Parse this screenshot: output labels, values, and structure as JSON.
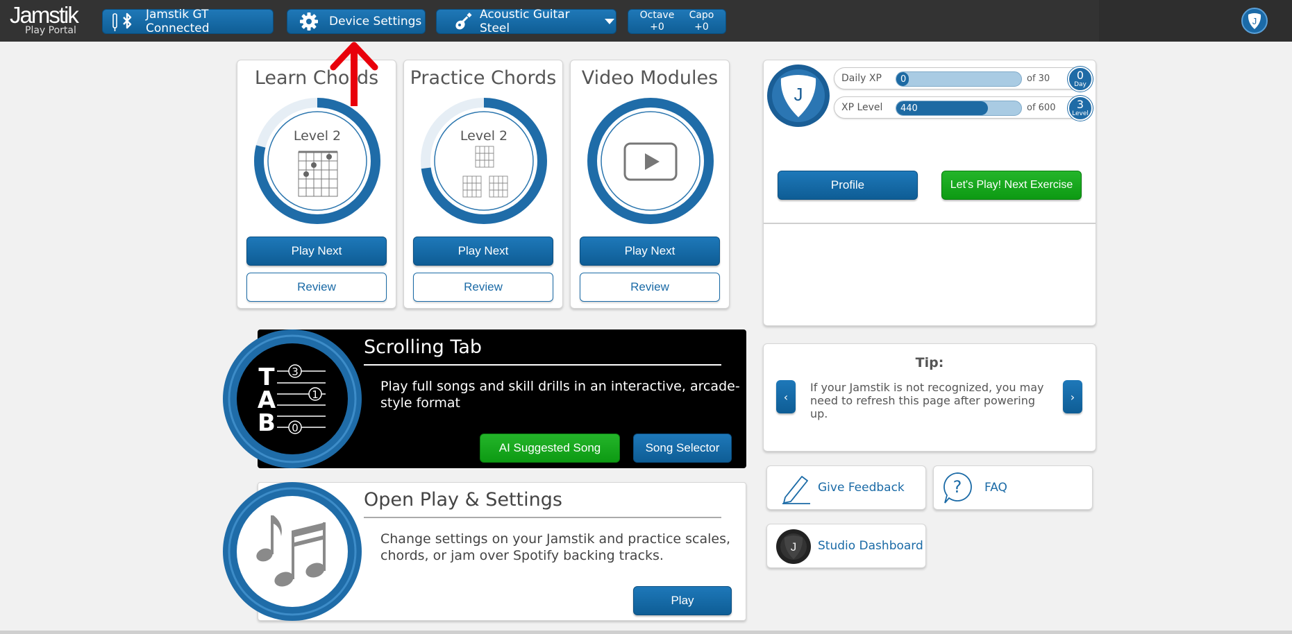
{
  "topbar": {
    "brand": "Jamstik",
    "brand_sub": "Play Portal",
    "connection_label": "Jamstik GT Connected",
    "device_settings_label": "Device Settings",
    "instrument_label": "Acoustic Guitar Steel",
    "octave_label": "Octave",
    "octave_value": "+0",
    "capo_label": "Capo",
    "capo_value": "+0",
    "user_initial": "J"
  },
  "modules": [
    {
      "title": "Learn Chords",
      "level": "Level 2",
      "progress": 0.79,
      "play_label": "Play Next",
      "review_label": "Review"
    },
    {
      "title": "Practice Chords",
      "level": "Level 2",
      "progress": 0.73,
      "play_label": "Play Next",
      "review_label": "Review"
    },
    {
      "title": "Video Modules",
      "play_label": "Play Next",
      "review_label": "Review"
    }
  ],
  "scrolling_tab": {
    "title": "Scrolling Tab",
    "description": "Play full songs and skill drills in an interactive, arcade-style format",
    "ai_button": "AI Suggested Song",
    "selector_button": "Song Selector",
    "icon_letters": [
      "T",
      "A",
      "B"
    ],
    "icon_numbers": [
      "3",
      "1",
      "0"
    ]
  },
  "open_play": {
    "title": "Open Play & Settings",
    "description": "Change settings on your Jamstik and practice scales, chords, or jam over Spotify backing tracks.",
    "play_button": "Play"
  },
  "profile": {
    "avatar_initial": "J",
    "daily_xp_label": "Daily XP",
    "daily_xp_value": "0",
    "daily_xp_of": "of 30",
    "daily_xp_fraction": 0.0,
    "day_count": "0",
    "day_unit": "Day",
    "xp_level_label": "XP Level",
    "xp_level_value": "440",
    "xp_level_of": "of 600",
    "xp_level_fraction": 0.733,
    "level_count": "3",
    "level_unit": "Level",
    "profile_button": "Profile",
    "next_button": "Let's Play! Next Exercise"
  },
  "tip": {
    "heading": "Tip:",
    "text": "If your Jamstik is not recognized, you may need to refresh this page after powering up.",
    "prev": "‹",
    "next": "›"
  },
  "links": {
    "feedback": "Give Feedback",
    "faq": "FAQ",
    "studio": "Studio Dashboard",
    "studio_initial": "J"
  },
  "colors": {
    "brand_blue": "#1a6aa6",
    "green": "#14a81a",
    "annotation_red": "#e8000b"
  }
}
